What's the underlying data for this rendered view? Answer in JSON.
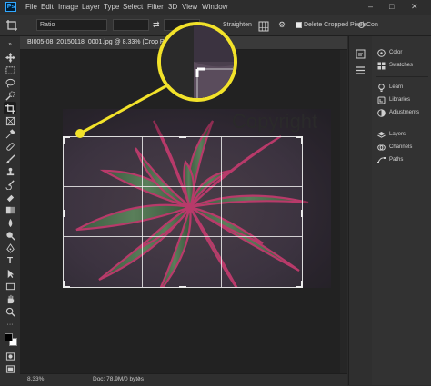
{
  "menu": {
    "logo": "Ps",
    "items": [
      "File",
      "Edit",
      "Image",
      "Layer",
      "Type",
      "Select",
      "Filter",
      "3D",
      "View",
      "Window"
    ],
    "window_controls": [
      "–",
      "□",
      "✕"
    ]
  },
  "options_bar": {
    "ratio_label": "Ratio",
    "straighten_label": "Straighten",
    "delete_cropped_label": "Delete Cropped Pixels",
    "content_aware_label": "Con"
  },
  "document": {
    "tab_title": "BI005-08_20150118_0001.jpg @ 8.33% (Crop Preview...",
    "watermark_text": "Copyright",
    "zoom": "8.33%",
    "doc_info": "Doc: 78.9M/0 bytes"
  },
  "panels": {
    "groups": [
      [
        "Color",
        "Swatches"
      ],
      [
        "Learn",
        "Libraries",
        "Adjustments"
      ],
      [
        "Layers",
        "Channels",
        "Paths"
      ]
    ]
  },
  "colors": {
    "accent_callout": "#f2e22a",
    "ps_blue": "#31a8ff"
  }
}
